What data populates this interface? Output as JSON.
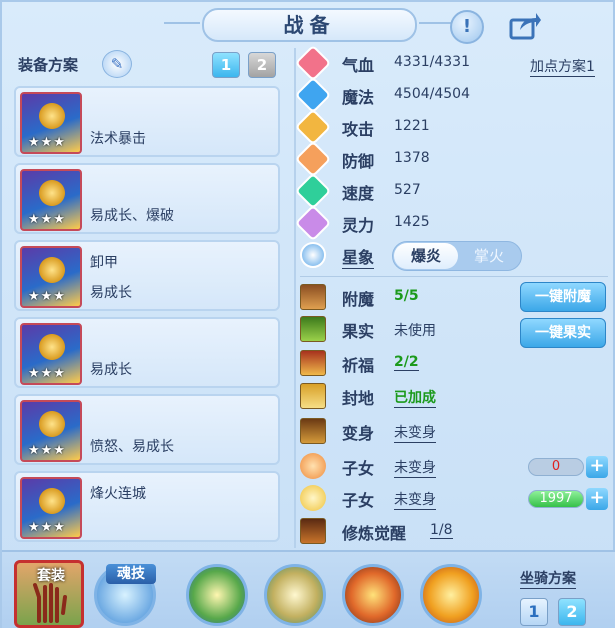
{
  "header": {
    "title": "战备",
    "alert_icon": "exclamation-icon",
    "share_icon": "share-icon"
  },
  "equip_plan": {
    "label": "装备方案",
    "tabs": [
      "1",
      "2"
    ],
    "active_tab": "1"
  },
  "equipment": [
    {
      "line1": "",
      "line2": "法术暴击",
      "stars": "★★★"
    },
    {
      "line1": "",
      "line2": "易成长、爆破",
      "stars": "★★★"
    },
    {
      "line1": "卸甲",
      "line2": "易成长",
      "stars": "★★★"
    },
    {
      "line1": "",
      "line2": "易成长",
      "stars": "★★★"
    },
    {
      "line1": "",
      "line2": "愤怒、易成长",
      "stars": "★★★"
    },
    {
      "line1": "烽火连城",
      "line2": "",
      "stars": "★★★"
    }
  ],
  "stats": {
    "add_plan": "加点方案1",
    "hp": {
      "name": "气血",
      "value": "4331/4331"
    },
    "mp": {
      "name": "魔法",
      "value": "4504/4504"
    },
    "atk": {
      "name": "攻击",
      "value": "1221"
    },
    "def": {
      "name": "防御",
      "value": "1378"
    },
    "spd": {
      "name": "速度",
      "value": "527"
    },
    "spirit": {
      "name": "灵力",
      "value": "1425"
    },
    "star": {
      "name": "星象",
      "options": [
        "爆炎",
        "掌火"
      ],
      "selected": "爆炎"
    }
  },
  "enhance": {
    "enchant": {
      "name": "附魔",
      "value": "5/5"
    },
    "fruit": {
      "name": "果实",
      "value": "未使用"
    },
    "bless": {
      "name": "祈福",
      "value": "2/2"
    },
    "fief": {
      "name": "封地",
      "value": "已加成"
    },
    "transform": {
      "name": "变身",
      "value": "未变身"
    },
    "child1": {
      "name": "子女",
      "value": "未变身",
      "bar": "0"
    },
    "child2": {
      "name": "子女",
      "value": "未变身",
      "bar": "1997"
    },
    "cultivate": {
      "name": "修炼觉醒",
      "value": "1/8"
    },
    "btn_enchant": "一键附魔",
    "btn_fruit": "一键果实"
  },
  "bottom": {
    "suit_label": "套装",
    "soul_label": "魂技",
    "mount_label": "坐骑方案",
    "mount_tabs": [
      "1",
      "2"
    ],
    "mount_active": "2"
  },
  "colors": {
    "panel_bg": "#cfe4f8",
    "accent_blue": "#3ba7e8",
    "green_value": "#1c9a1c",
    "red_value": "#e02020"
  }
}
